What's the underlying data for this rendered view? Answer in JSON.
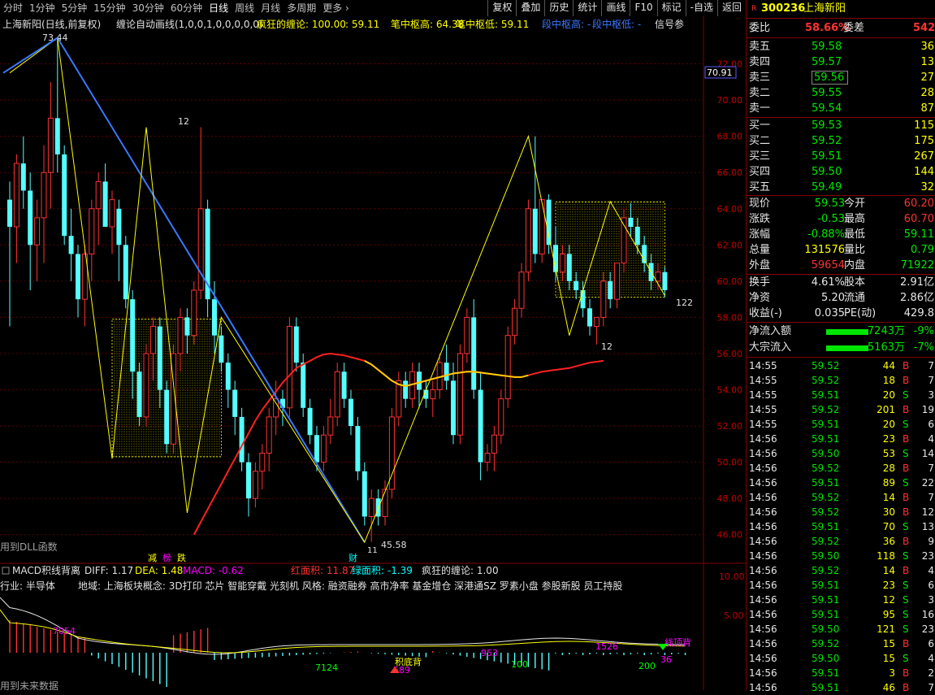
{
  "toolbar": {
    "periods": [
      "分时",
      "1分钟",
      "5分钟",
      "15分钟",
      "30分钟",
      "60分钟",
      "日线",
      "周线",
      "月线",
      "多周期",
      "更多 ›"
    ],
    "active_period": "日线",
    "buttons": [
      "复权",
      "叠加",
      "历史",
      "统计",
      "画线",
      "F10",
      "标记",
      "-自选",
      "返回"
    ]
  },
  "chart_header": {
    "title": "上海新阳(日线,前复权)",
    "indicator": "缠论自动画线(1,0,0,1,0,0,0,0,0)",
    "item1_label": "疯狂的缠论: 100.00",
    "item2_label": ": 59.11",
    "item3_label": "笔中枢高: 64.38",
    "item4_label": "笔中枢低: 59.11",
    "item5_label": "段中枢高: -",
    "item6_label": "段中枢低: -",
    "item7_label": "信号参"
  },
  "price_axis": {
    "ticks": [
      "72.00",
      "70.00",
      "68.00",
      "66.00",
      "64.00",
      "62.00",
      "60.00",
      "58.00",
      "56.00",
      "54.00",
      "52.00",
      "50.00",
      "48.00",
      "46.00"
    ],
    "cursor_value": "70.91"
  },
  "chart_labels": {
    "high_label": "73.44",
    "low_label": "45.58",
    "low_index": "11",
    "pivot_12a": "12",
    "pivot_12b": "12",
    "pivot_122": "122",
    "dll_text": "用到DLL函数",
    "sig_jian": "减",
    "sig_bang": "榜",
    "sig_die": "跌",
    "sig_cai": "财"
  },
  "chart_data": {
    "type": "candlestick",
    "ylim": [
      45,
      74
    ],
    "candles": [
      [
        64.5,
        65.5,
        57.5,
        63.0
      ],
      [
        63.0,
        67.0,
        61.0,
        66.5
      ],
      [
        66.5,
        68.0,
        64.0,
        65.0
      ],
      [
        65.0,
        66.0,
        59.5,
        62.0
      ],
      [
        62.0,
        64.5,
        60.0,
        63.5
      ],
      [
        63.5,
        67.5,
        61.0,
        66.0
      ],
      [
        66.0,
        71.0,
        64.0,
        69.0
      ],
      [
        69.0,
        73.4,
        66.0,
        67.0
      ],
      [
        67.0,
        67.5,
        62.0,
        62.5
      ],
      [
        62.5,
        64.0,
        60.0,
        61.5
      ],
      [
        61.5,
        62.0,
        58.0,
        59.0
      ],
      [
        59.0,
        62.0,
        57.5,
        61.5
      ],
      [
        61.5,
        64.5,
        60.0,
        64.0
      ],
      [
        64.0,
        66.0,
        62.0,
        65.5
      ],
      [
        65.5,
        66.5,
        63.0,
        63.0
      ],
      [
        63.0,
        65.0,
        61.5,
        64.5
      ],
      [
        64.0,
        64.5,
        60.0,
        62.0
      ],
      [
        62.0,
        62.5,
        58.5,
        59.0
      ],
      [
        59.0,
        59.5,
        53.5,
        55.0
      ],
      [
        55.0,
        55.5,
        52.0,
        52.5
      ],
      [
        52.5,
        56.5,
        52.0,
        56.0
      ],
      [
        56.0,
        58.0,
        54.5,
        57.5
      ],
      [
        57.5,
        58.0,
        53.0,
        54.0
      ],
      [
        54.0,
        54.5,
        50.5,
        51.0
      ],
      [
        51.0,
        56.5,
        50.5,
        56.0
      ],
      [
        56.0,
        58.5,
        55.0,
        58.0
      ],
      [
        58.0,
        58.5,
        56.0,
        57.0
      ],
      [
        57.0,
        60.0,
        56.5,
        59.5
      ],
      [
        59.5,
        68.5,
        59.0,
        64.0
      ],
      [
        64.0,
        64.5,
        58.0,
        59.0
      ],
      [
        59.0,
        60.0,
        56.0,
        57.0
      ],
      [
        57.0,
        57.5,
        55.0,
        55.5
      ],
      [
        55.5,
        56.0,
        53.0,
        54.0
      ],
      [
        54.0,
        54.5,
        51.5,
        52.5
      ],
      [
        52.5,
        53.0,
        49.5,
        50.0
      ],
      [
        50.0,
        50.5,
        47.0,
        48.0
      ],
      [
        48.0,
        50.0,
        47.5,
        49.5
      ],
      [
        49.5,
        51.0,
        48.5,
        50.5
      ],
      [
        50.5,
        53.0,
        49.5,
        52.5
      ],
      [
        52.5,
        54.5,
        51.5,
        53.5
      ],
      [
        53.5,
        54.0,
        52.0,
        53.0
      ],
      [
        53.0,
        58.0,
        52.5,
        57.5
      ],
      [
        57.5,
        58.0,
        55.0,
        55.5
      ],
      [
        55.5,
        56.0,
        52.5,
        53.0
      ],
      [
        53.0,
        53.5,
        51.0,
        51.5
      ],
      [
        51.5,
        52.0,
        49.5,
        50.0
      ],
      [
        50.0,
        52.0,
        49.5,
        51.5
      ],
      [
        51.5,
        53.5,
        51.0,
        52.5
      ],
      [
        52.5,
        55.5,
        52.0,
        55.0
      ],
      [
        55.0,
        55.5,
        53.0,
        53.5
      ],
      [
        53.5,
        54.0,
        51.5,
        52.0
      ],
      [
        52.0,
        52.5,
        49.0,
        49.5
      ],
      [
        49.5,
        50.0,
        46.5,
        47.0
      ],
      [
        47.0,
        48.5,
        45.6,
        48.0
      ],
      [
        48.0,
        48.5,
        46.5,
        47.0
      ],
      [
        47.0,
        49.0,
        46.5,
        48.5
      ],
      [
        48.5,
        53.0,
        48.0,
        52.5
      ],
      [
        52.5,
        55.0,
        52.0,
        54.5
      ],
      [
        54.5,
        55.0,
        53.0,
        53.5
      ],
      [
        53.5,
        55.5,
        53.0,
        55.0
      ],
      [
        55.0,
        55.5,
        53.0,
        54.0
      ],
      [
        54.0,
        54.5,
        53.0,
        53.5
      ],
      [
        53.5,
        54.5,
        52.5,
        54.0
      ],
      [
        54.0,
        56.0,
        53.5,
        55.5
      ],
      [
        55.5,
        56.5,
        54.0,
        54.5
      ],
      [
        54.5,
        55.5,
        51.0,
        51.5
      ],
      [
        51.5,
        56.5,
        51.0,
        56.0
      ],
      [
        56.0,
        58.5,
        55.5,
        58.0
      ],
      [
        58.0,
        59.0,
        53.5,
        54.0
      ],
      [
        54.0,
        55.0,
        49.0,
        50.0
      ],
      [
        50.0,
        51.0,
        49.5,
        50.5
      ],
      [
        50.5,
        52.0,
        49.5,
        51.5
      ],
      [
        51.5,
        54.0,
        51.0,
        53.5
      ],
      [
        53.5,
        57.5,
        53.0,
        57.0
      ],
      [
        57.0,
        59.0,
        56.5,
        58.5
      ],
      [
        58.5,
        61.0,
        58.0,
        60.5
      ],
      [
        60.5,
        64.5,
        60.0,
        64.0
      ],
      [
        64.0,
        68.0,
        61.0,
        61.5
      ],
      [
        61.5,
        64.5,
        61.0,
        64.5
      ],
      [
        64.5,
        64.8,
        61.5,
        62.0
      ],
      [
        62.0,
        63.0,
        60.0,
        60.5
      ],
      [
        60.5,
        62.0,
        60.0,
        61.5
      ],
      [
        61.5,
        62.0,
        59.5,
        60.0
      ],
      [
        60.0,
        60.5,
        59.0,
        59.5
      ],
      [
        59.5,
        60.0,
        58.0,
        58.5
      ],
      [
        58.5,
        59.0,
        57.0,
        57.5
      ],
      [
        57.5,
        58.0,
        56.5,
        58.0
      ],
      [
        58.0,
        60.5,
        57.5,
        60.0
      ],
      [
        60.0,
        60.5,
        58.5,
        59.0
      ],
      [
        59.0,
        61.0,
        58.5,
        61.0
      ],
      [
        61.0,
        64.0,
        60.5,
        63.5
      ],
      [
        63.5,
        64.3,
        62.5,
        63.0
      ],
      [
        63.0,
        63.5,
        61.5,
        62.0
      ],
      [
        62.0,
        62.5,
        60.5,
        61.0
      ],
      [
        61.0,
        61.5,
        59.5,
        60.0
      ],
      [
        60.0,
        61.0,
        59.5,
        60.5
      ],
      [
        60.5,
        60.8,
        59.1,
        59.5
      ]
    ],
    "ma": [
      null,
      null,
      null,
      null,
      null,
      null,
      null,
      null,
      null,
      null,
      null,
      null,
      null,
      null,
      null,
      null,
      null,
      null,
      null,
      null,
      null,
      null,
      null,
      null,
      null,
      null,
      null,
      46.0,
      46.7,
      47.4,
      48.1,
      48.8,
      49.5,
      50.2,
      50.9,
      51.6,
      52.3,
      52.9,
      53.4,
      53.9,
      54.4,
      54.8,
      55.2,
      55.4,
      55.6,
      55.8,
      55.95,
      56.0,
      55.95,
      55.9,
      55.8,
      55.7,
      55.6,
      55.4,
      55.1,
      54.8,
      54.5,
      54.3,
      54.2,
      54.3,
      54.4,
      54.5,
      54.6,
      54.7,
      54.8,
      54.9,
      54.95,
      55.0,
      55.0,
      54.95,
      54.9,
      54.85,
      54.8,
      54.75,
      54.7,
      54.7,
      54.8,
      54.9,
      55.0,
      55.05,
      55.1,
      55.15,
      55.2,
      55.3,
      55.4,
      55.5,
      55.55,
      55.6
    ],
    "bi_points": [
      [
        0,
        71.5
      ],
      [
        7,
        73.44
      ],
      [
        15,
        50.2
      ],
      [
        20,
        68.5
      ],
      [
        26,
        47.2
      ],
      [
        31,
        58.0
      ],
      [
        52,
        45.58
      ],
      [
        76,
        68.0
      ],
      [
        82,
        57.0
      ],
      [
        88,
        64.4
      ],
      [
        96,
        59.2
      ]
    ],
    "segment": [
      [
        7,
        73.44
      ],
      [
        52,
        45.58
      ]
    ],
    "pivot_boxes": [
      {
        "x0": 15,
        "x1": 31,
        "high": 57.9,
        "low": 50.3
      },
      {
        "x0": 80,
        "x1": 96,
        "high": 64.38,
        "low": 59.11
      }
    ]
  },
  "macd": {
    "header_name": "MACD积线背离",
    "diff": "DIFF: 1.17",
    "dea": "DEA: 1.48",
    "macd": "MACD: -0.62",
    "red_area": "红面积: 11.87",
    "green_area": "绿面积: -1.39",
    "crazy": "疯狂的缠论: 1.00",
    "axis_ticks": [
      "10.00",
      "5.00"
    ],
    "industry_text": "行业: 半导体",
    "region_text": "地域: 上海板块概念: 3D打印 芯片 智能穿戴 光刻机 风格: 融资融券 高市净率 基金增仓 深港通SZ 罗素小盘 参股新股 员工持股",
    "lbl_7054": "7054",
    "lbl_7124": "7124",
    "lbl_953": "953",
    "lbl_589": "589",
    "lbl_100": "100",
    "lbl_1526": "1526",
    "lbl_200": "200",
    "lbl_36": "36",
    "lbl_bottom": "积底背",
    "lbl_top": "线顶背",
    "footer": "用到未来数据"
  },
  "side": {
    "code": "300236",
    "name": "上海新阳",
    "r_mark": "R",
    "weibi_label": "委比",
    "weibi_value": "58.66%",
    "weicha_label": "委差",
    "weicha_value": "542",
    "asks": [
      {
        "label": "卖五",
        "price": "59.58",
        "vol": "36"
      },
      {
        "label": "卖四",
        "price": "59.57",
        "vol": "13"
      },
      {
        "label": "卖三",
        "price": "59.56",
        "vol": "27"
      },
      {
        "label": "卖二",
        "price": "59.55",
        "vol": "28"
      },
      {
        "label": "卖一",
        "price": "59.54",
        "vol": "87"
      }
    ],
    "bids": [
      {
        "label": "买一",
        "price": "59.53",
        "vol": "115"
      },
      {
        "label": "买二",
        "price": "59.52",
        "vol": "175"
      },
      {
        "label": "买三",
        "price": "59.51",
        "vol": "267"
      },
      {
        "label": "买四",
        "price": "59.50",
        "vol": "144"
      },
      {
        "label": "买五",
        "price": "59.49",
        "vol": "32"
      }
    ],
    "stats": [
      {
        "l1": "现价",
        "v1": "59.53",
        "c1": "grn",
        "l2": "今开",
        "v2": "60.20",
        "c2": "red"
      },
      {
        "l1": "涨跌",
        "v1": "-0.53",
        "c1": "grn",
        "l2": "最高",
        "v2": "60.70",
        "c2": "red"
      },
      {
        "l1": "涨幅",
        "v1": "-0.88%",
        "c1": "grn",
        "l2": "最低",
        "v2": "59.11",
        "c2": "grn"
      },
      {
        "l1": "总量",
        "v1": "131576",
        "c1": "yel",
        "l2": "量比",
        "v2": "0.79",
        "c2": "grn"
      },
      {
        "l1": "外盘",
        "v1": "59654",
        "c1": "red",
        "l2": "内盘",
        "v2": "71922",
        "c2": "grn"
      }
    ],
    "stats2": [
      {
        "l1": "换手",
        "v1": "4.61%",
        "l2": "股本",
        "v2": "2.91亿"
      },
      {
        "l1": "净资",
        "v1": "5.20",
        "l2": "流通",
        "v2": "2.86亿"
      },
      {
        "l1": "收益(-)",
        "v1": "0.035",
        "l2": "PE(动)",
        "v2": "429.8"
      }
    ],
    "flow": [
      {
        "label": "净流入额",
        "fill": 0.65,
        "value": "-7243万",
        "pct": "-9%"
      },
      {
        "label": "大宗流入",
        "fill": 0.65,
        "value": "-5163万",
        "pct": "-7%"
      }
    ],
    "ticks": [
      {
        "t": "14:55",
        "p": "59.52",
        "v": "44",
        "s": "B",
        "x": "7"
      },
      {
        "t": "14:55",
        "p": "59.52",
        "v": "18",
        "s": "B",
        "x": "7"
      },
      {
        "t": "14:55",
        "p": "59.51",
        "v": "20",
        "s": "S",
        "x": "3"
      },
      {
        "t": "14:55",
        "p": "59.52",
        "v": "201",
        "s": "B",
        "x": "19"
      },
      {
        "t": "14:55",
        "p": "59.51",
        "v": "20",
        "s": "S",
        "x": "6"
      },
      {
        "t": "14:56",
        "p": "59.51",
        "v": "23",
        "s": "B",
        "x": "4"
      },
      {
        "t": "14:56",
        "p": "59.50",
        "v": "53",
        "s": "S",
        "x": "14"
      },
      {
        "t": "14:56",
        "p": "59.52",
        "v": "28",
        "s": "B",
        "x": "7"
      },
      {
        "t": "14:56",
        "p": "59.51",
        "v": "89",
        "s": "S",
        "x": "22"
      },
      {
        "t": "14:56",
        "p": "59.52",
        "v": "14",
        "s": "B",
        "x": "7"
      },
      {
        "t": "14:56",
        "p": "59.52",
        "v": "30",
        "s": "B",
        "x": "12"
      },
      {
        "t": "14:56",
        "p": "59.51",
        "v": "70",
        "s": "S",
        "x": "13"
      },
      {
        "t": "14:56",
        "p": "59.52",
        "v": "36",
        "s": "B",
        "x": "9"
      },
      {
        "t": "14:56",
        "p": "59.50",
        "v": "118",
        "s": "S",
        "x": "23"
      },
      {
        "t": "14:56",
        "p": "59.52",
        "v": "14",
        "s": "B",
        "x": "4"
      },
      {
        "t": "14:56",
        "p": "59.51",
        "v": "23",
        "s": "S",
        "x": "6"
      },
      {
        "t": "14:56",
        "p": "59.51",
        "v": "12",
        "s": "S",
        "x": "3"
      },
      {
        "t": "14:56",
        "p": "59.51",
        "v": "95",
        "s": "S",
        "x": "16"
      },
      {
        "t": "14:56",
        "p": "59.50",
        "v": "121",
        "s": "S",
        "x": "23"
      },
      {
        "t": "14:56",
        "p": "59.52",
        "v": "15",
        "s": "B",
        "x": "6"
      },
      {
        "t": "14:56",
        "p": "59.50",
        "v": "15",
        "s": "S",
        "x": "4"
      },
      {
        "t": "14:56",
        "p": "59.51",
        "v": "3",
        "s": "B",
        "x": "2"
      },
      {
        "t": "14:56",
        "p": "59.51",
        "v": "46",
        "s": "B",
        "x": "7"
      }
    ]
  }
}
